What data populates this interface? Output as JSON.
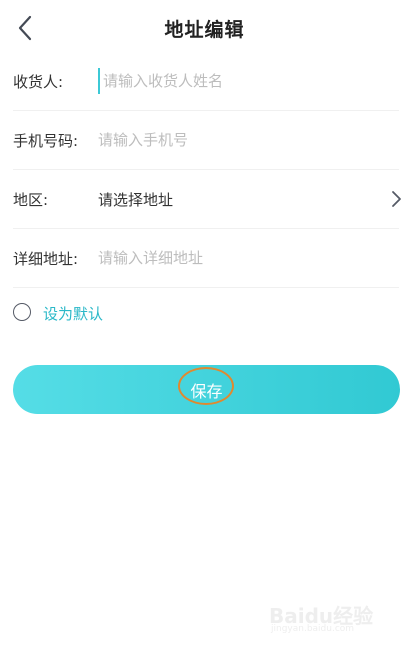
{
  "header": {
    "title": "地址编辑"
  },
  "form": {
    "consignee": {
      "label": "收货人:",
      "placeholder": "请输入收货人姓名",
      "value": ""
    },
    "phone": {
      "label": "手机号码:",
      "placeholder": "请输入手机号",
      "value": ""
    },
    "region": {
      "label": "地区:",
      "value": "请选择地址"
    },
    "detail": {
      "label": "详细地址:",
      "placeholder": "请输入详细地址",
      "value": ""
    }
  },
  "default_option": {
    "label": "设为默认",
    "checked": false
  },
  "save_button": {
    "label": "保存"
  },
  "icons": {
    "back": "chevron-left-icon",
    "region_arrow": "chevron-right-icon",
    "default_radio": "radio-unchecked-icon"
  },
  "colors": {
    "accent": "#2bb8c8",
    "button_gradient_start": "#55dde6",
    "button_gradient_end": "#31c9d3",
    "highlight_ring": "#e0892f"
  },
  "watermark": {
    "text": "Baidu经验",
    "sub": "jingyan.baidu.com"
  }
}
